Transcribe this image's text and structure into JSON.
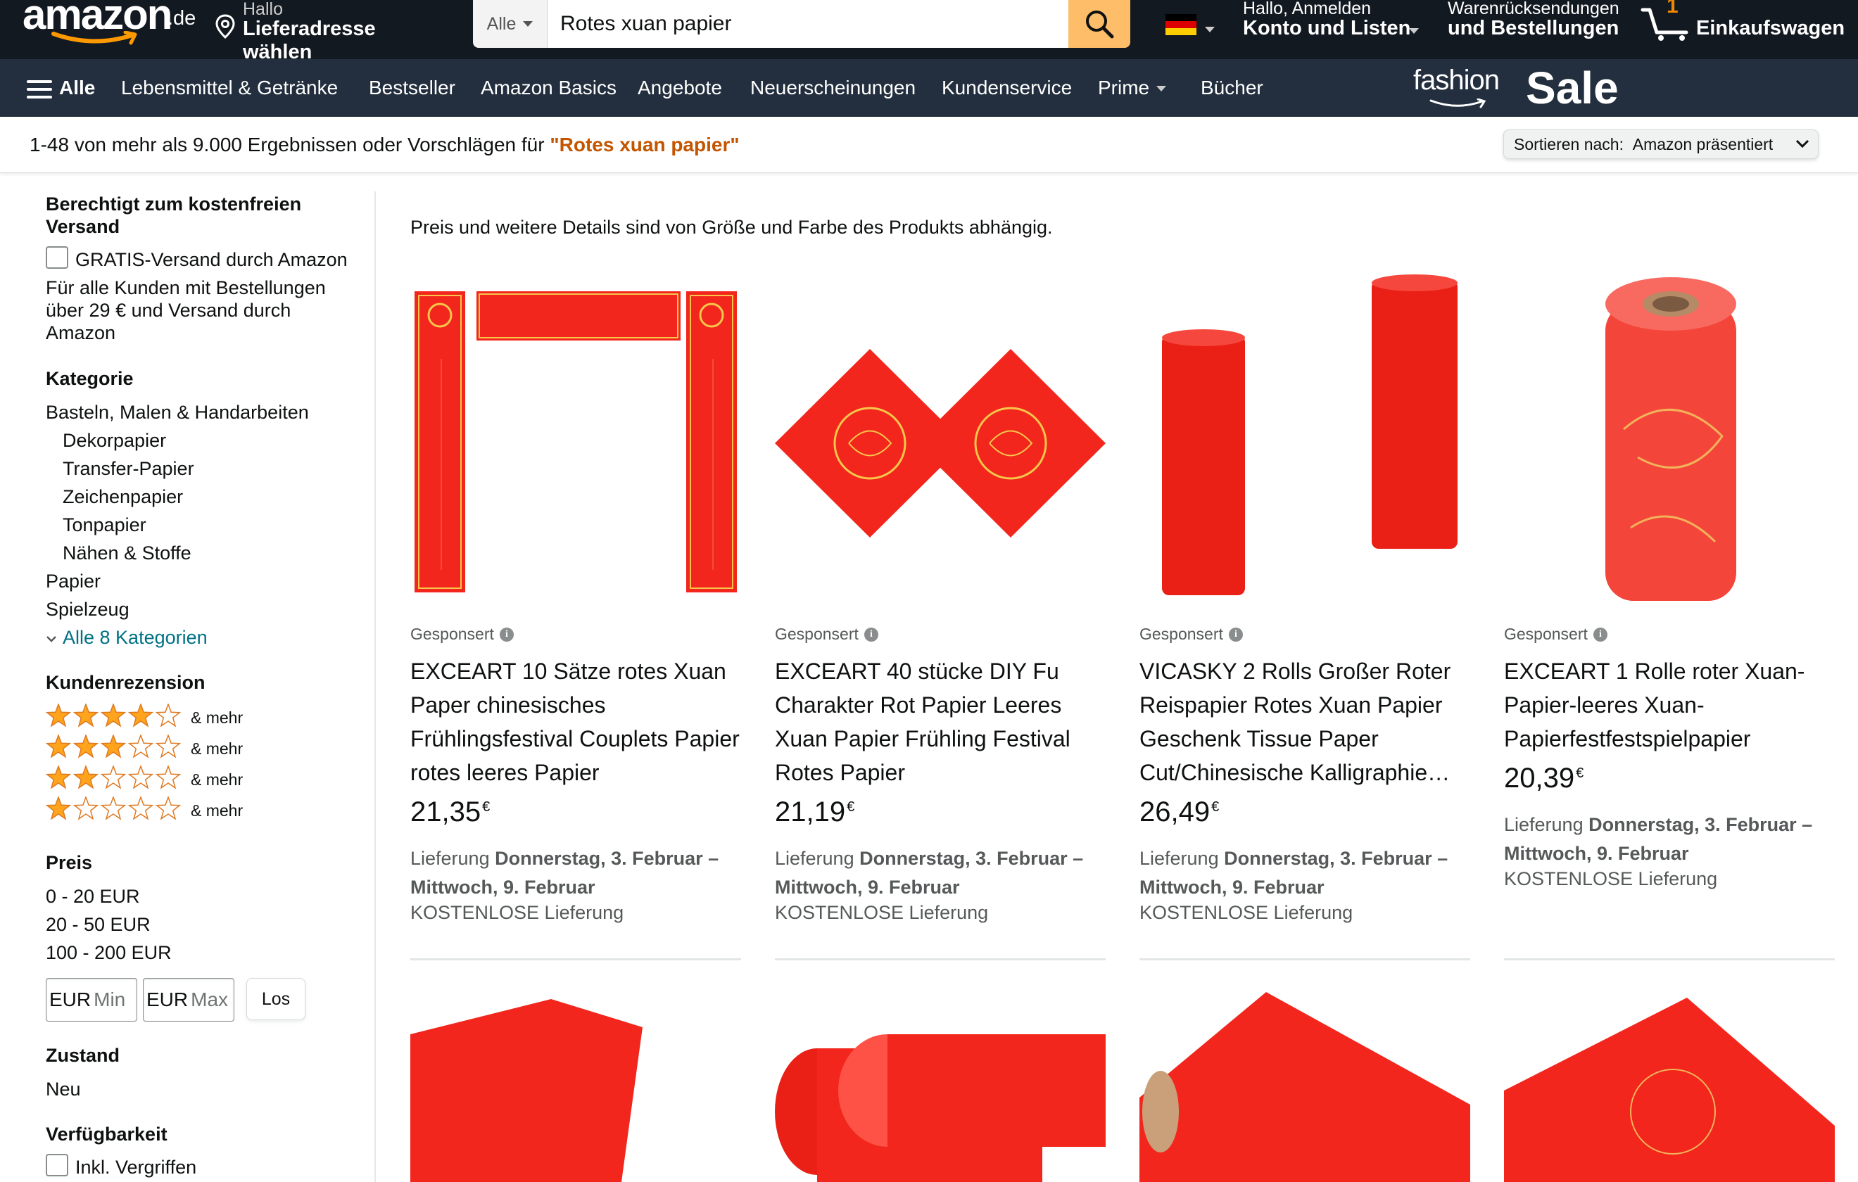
{
  "header": {
    "logo_text": "amazon",
    "logo_tld": ".de",
    "deliver_line1": "Hallo",
    "deliver_line2": "Lieferadresse wählen",
    "search_category": "Alle",
    "search_value": "Rotes xuan papier",
    "account_line1": "Hallo, Anmelden",
    "account_line2": "Konto und Listen",
    "orders_line1": "Warenrücksendungen",
    "orders_line2": "und Bestellungen",
    "cart_count": "1",
    "cart_label": "Einkaufswagen"
  },
  "subnav": {
    "all_label": "Alle",
    "items": [
      "Lebensmittel & Getränke",
      "Bestseller",
      "Amazon Basics",
      "Angebote",
      "Neuerscheinungen",
      "Kundenservice",
      "Prime",
      "Bücher"
    ],
    "promo_fashion": "fashion",
    "promo_sale": "Sale"
  },
  "results": {
    "prefix": "1-48 von mehr als 9.000 Ergebnissen oder Vorschlägen für ",
    "query": "\"Rotes xuan papier\"",
    "sort_label": "Sortieren nach:",
    "sort_value": "Amazon präsentiert"
  },
  "sidebar": {
    "shipping_heading": "Berechtigt zum kostenfreien Versand",
    "shipping_option": "GRATIS-Versand durch Amazon",
    "shipping_note": "Für alle Kunden mit Bestellungen über 29 € und Versand durch Amazon",
    "category_heading": "Kategorie",
    "categories": [
      {
        "label": "Basteln, Malen & Handarbeiten",
        "indent": false
      },
      {
        "label": "Dekorpapier",
        "indent": true
      },
      {
        "label": "Transfer-Papier",
        "indent": true
      },
      {
        "label": "Zeichenpapier",
        "indent": true
      },
      {
        "label": "Tonpapier",
        "indent": true
      },
      {
        "label": "Nähen & Stoffe",
        "indent": true
      },
      {
        "label": "Papier",
        "indent": false
      },
      {
        "label": "Spielzeug",
        "indent": false
      }
    ],
    "all_categories": "Alle 8 Kategorien",
    "review_heading": "Kundenrezension",
    "review_rows": [
      {
        "stars": 4,
        "label": "& mehr"
      },
      {
        "stars": 3,
        "label": "& mehr"
      },
      {
        "stars": 2,
        "label": "& mehr"
      },
      {
        "stars": 1,
        "label": "& mehr"
      }
    ],
    "price_heading": "Preis",
    "price_ranges": [
      "0 - 20 EUR",
      "20 - 50 EUR",
      "100 - 200 EUR"
    ],
    "price_min_currency": "EUR",
    "price_min_placeholder": "Min",
    "price_max_currency": "EUR",
    "price_max_placeholder": "Max",
    "price_go": "Los",
    "condition_heading": "Zustand",
    "condition_value": "Neu",
    "availability_heading": "Verfügbarkeit",
    "availability_option": "Inkl. Vergriffen"
  },
  "main": {
    "notice": "Preis und weitere Details sind von Größe und Farbe des Produkts abhängig.",
    "products": [
      {
        "sponsored": "Gesponsert",
        "title": "EXCEART 10 Sätze rotes Xuan Paper chinesisches Frühlingsfestival Couplets Papier rotes leeres Papier",
        "price_main": "21,35",
        "price_currency": "€",
        "delivery_prefix": "Lieferung ",
        "delivery_dates": "Donnerstag, 3. Februar – Mittwoch, 9. Februar",
        "shipping": "KOSTENLOSE Lieferung",
        "image": "couplets-image"
      },
      {
        "sponsored": "Gesponsert",
        "title": "EXCEART 40 stücke DIY Fu Charakter Rot Papier Leeres Xuan Papier Frühling Festival Rotes Papier",
        "price_main": "21,19",
        "price_currency": "€",
        "delivery_prefix": "Lieferung ",
        "delivery_dates": "Donnerstag, 3. Februar – Mittwoch, 9. Februar",
        "shipping": "KOSTENLOSE Lieferung",
        "image": "diamond-paper-image"
      },
      {
        "sponsored": "Gesponsert",
        "title": "VICASKY 2 Rolls Großer Roter Reispapier Rotes Xuan Papier Geschenk Tissue Paper Cut/Chinesische Kalligraphie…",
        "price_main": "26,49",
        "price_currency": "€",
        "delivery_prefix": "Lieferung ",
        "delivery_dates": "Donnerstag, 3. Februar – Mittwoch, 9. Februar",
        "shipping": "KOSTENLOSE Lieferung",
        "image": "two-rolls-image"
      },
      {
        "sponsored": "Gesponsert",
        "title": "EXCEART 1 Rolle roter Xuan-Papier-leeres Xuan-Papierfestfestspielpapier",
        "price_main": "20,39",
        "price_currency": "€",
        "delivery_prefix": "Lieferung ",
        "delivery_dates": "Donnerstag, 3. Februar – Mittwoch, 9. Februar",
        "shipping": "KOSTENLOSE Lieferung",
        "image": "single-roll-image"
      }
    ]
  },
  "colors": {
    "nav_dark": "#131921",
    "nav_sub": "#232f3e",
    "search_button": "#febd69",
    "link": "#007185",
    "query_orange": "#c45500",
    "star": "#ffa41c",
    "paper_red": "#f2261c"
  }
}
